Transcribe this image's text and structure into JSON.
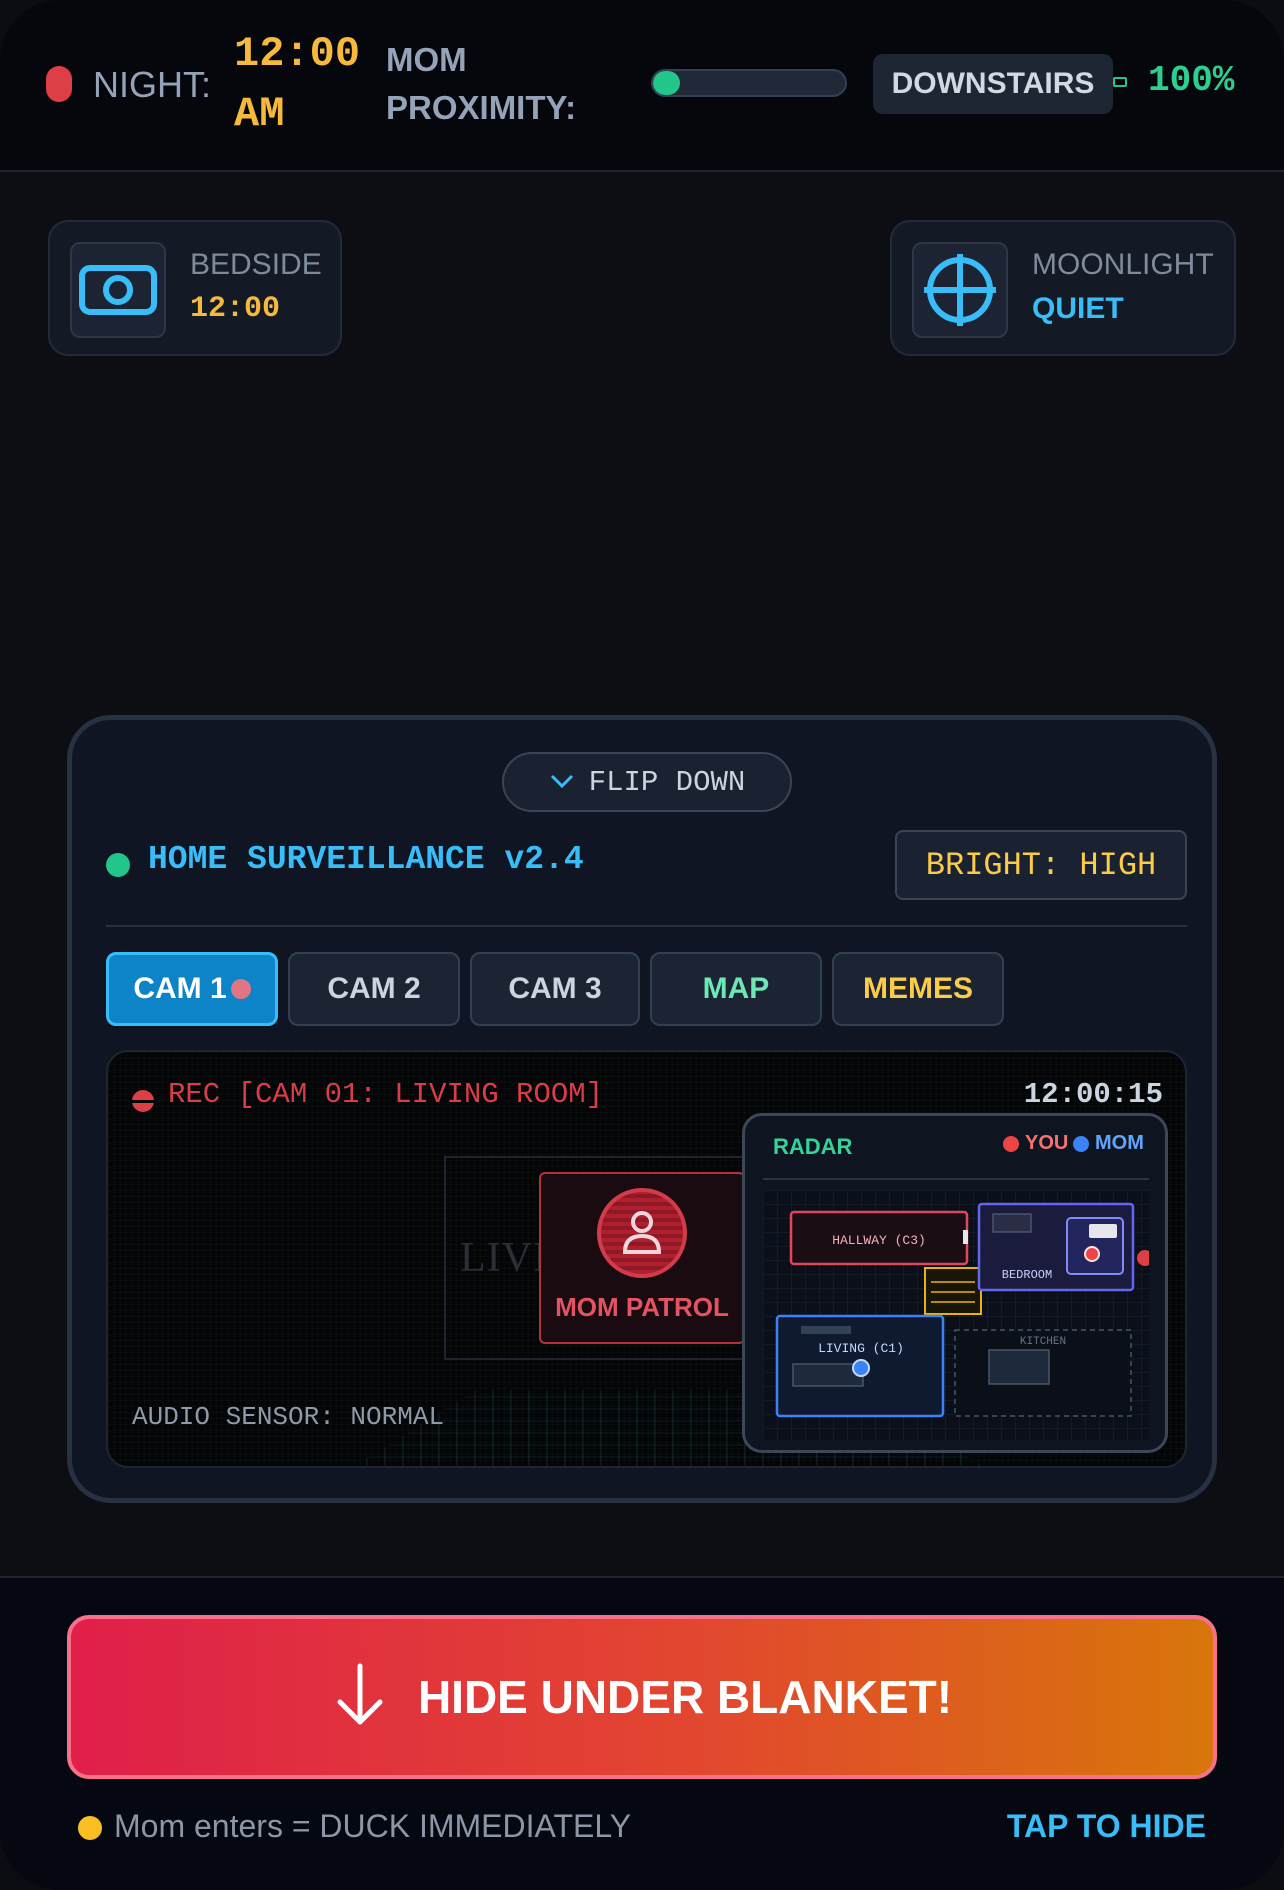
{
  "status_bar": {
    "night_label": "NIGHT:",
    "night_time": "12:00 AM",
    "proximity_label": "MOM PROXIMITY:",
    "proximity_level": 0.14,
    "location": "DOWNSTAIRS",
    "battery": "100%"
  },
  "widgets": {
    "bedside": {
      "title": "BEDSIDE",
      "value": "12:00"
    },
    "moonlight": {
      "title": "MOONLIGHT",
      "value": "QUIET"
    }
  },
  "panel": {
    "flip_label": "FLIP DOWN",
    "title": "HOME SURVEILLANCE v2.4",
    "brightness": "BRIGHT: HIGH",
    "tabs": [
      {
        "label": "CAM 1",
        "color": "#ffffff"
      },
      {
        "label": "CAM 2",
        "color": "#cbd5e1"
      },
      {
        "label": "CAM 3",
        "color": "#cbd5e1"
      },
      {
        "label": "MAP",
        "color": "#6ee7b7"
      },
      {
        "label": "MEMES",
        "color": "#facc48"
      }
    ]
  },
  "feed": {
    "rec_label": "REC [CAM 01: LIVING ROOM]",
    "timestamp": "12:00:15",
    "ghost_text": "LIVING ROOM S",
    "alert_label": "MOM PATROL",
    "audio": "AUDIO SENSOR: NORMAL"
  },
  "radar": {
    "title": "RADAR",
    "legend_you": "YOU",
    "legend_mom": "MOM",
    "rooms": {
      "hallway": "HALLWAY (C3)",
      "bedroom": "BEDROOM",
      "living": "LIVING (C1)",
      "kitchen": "KITCHEN"
    }
  },
  "bottom": {
    "hide_label": "HIDE UNDER BLANKET!",
    "warning": "Mom enters = DUCK IMMEDIATELY",
    "tap_hint": "TAP TO HIDE"
  },
  "colors": {
    "accent": "#38bdf8",
    "warning": "#facc48",
    "danger": "#dc3f45",
    "ok": "#22c58a"
  }
}
